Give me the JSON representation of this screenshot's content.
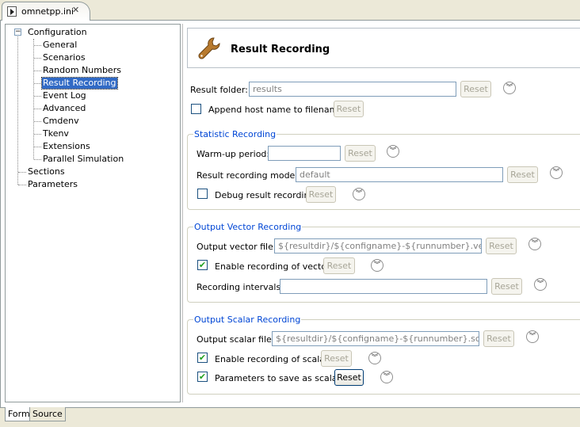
{
  "editor_tab": {
    "title": "omnetpp.ini",
    "close_glyph": "✕",
    "icon": "ini-file-icon"
  },
  "tree": {
    "root": "Configuration",
    "children": [
      "General",
      "Scenarios",
      "Random Numbers",
      "Result Recording",
      "Event Log",
      "Advanced",
      "Cmdenv",
      "Tkenv",
      "Extensions",
      "Parallel Simulation"
    ],
    "selected": "Result Recording",
    "siblings": [
      "Sections",
      "Parameters"
    ],
    "expander_glyph": "−"
  },
  "header": {
    "title": "Result Recording",
    "icon": "wrench-icon"
  },
  "form": {
    "result_folder": {
      "label": "Result folder:",
      "value": "results",
      "reset": "Reset"
    },
    "append_host": {
      "label": "Append host name to filenames",
      "checked": false,
      "reset": "Reset"
    },
    "statistic": {
      "title": "Statistic Recording",
      "warmup": {
        "label": "Warm-up period:",
        "value": "",
        "reset": "Reset"
      },
      "modes": {
        "label": "Result recording modes:",
        "value": "default",
        "reset": "Reset"
      },
      "debug": {
        "label": "Debug result recording",
        "checked": false,
        "reset": "Reset"
      }
    },
    "vector": {
      "title": "Output Vector Recording",
      "file": {
        "label": "Output vector file:",
        "value": "${resultdir}/${configname}-${runnumber}.vec",
        "reset": "Reset"
      },
      "enable": {
        "label": "Enable recording of vectors",
        "checked": true,
        "check_glyph": "✔",
        "reset": "Reset"
      },
      "intervals": {
        "label": "Recording intervals:",
        "value": "",
        "reset": "Reset"
      }
    },
    "scalar": {
      "title": "Output Scalar Recording",
      "file": {
        "label": "Output scalar file:",
        "value": "${resultdir}/${configname}-${runnumber}.sca",
        "reset": "Reset"
      },
      "enable": {
        "label": "Enable recording of scalars",
        "checked": true,
        "check_glyph": "✔",
        "reset": "Reset"
      },
      "params": {
        "label": "Parameters to save as scalars",
        "checked": true,
        "check_glyph": "✔",
        "reset": "Reset"
      }
    },
    "chevron_glyph": "︾"
  },
  "bottom_tabs": [
    "Form",
    "Source"
  ],
  "colors": {
    "selection": "#316ac5",
    "group_title": "#0046d5",
    "check": "#21a121"
  }
}
